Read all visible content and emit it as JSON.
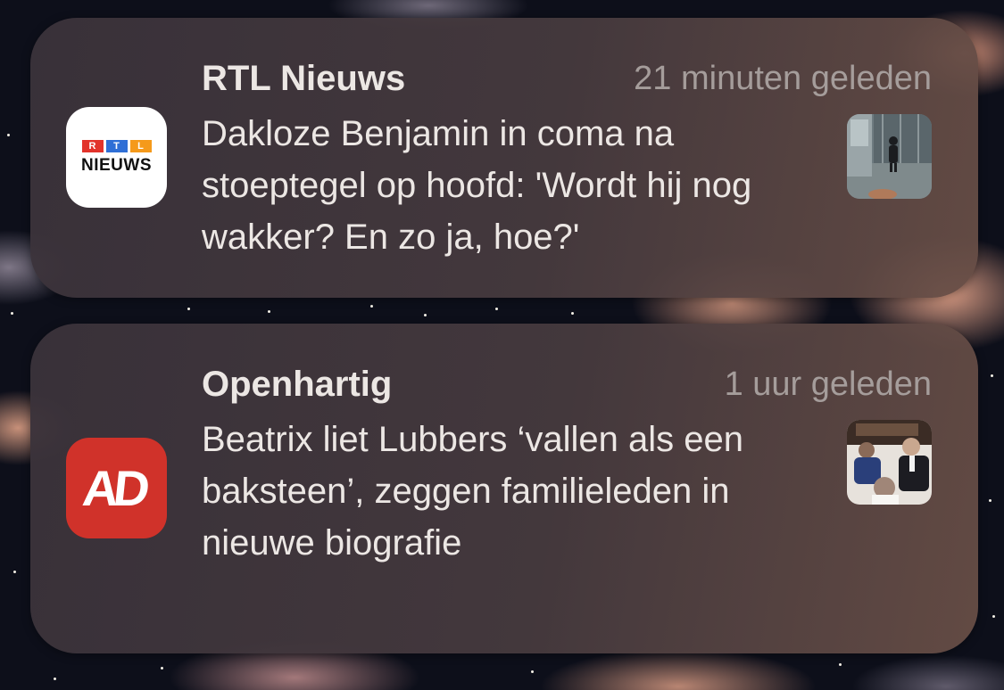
{
  "notifications": [
    {
      "app_name": "RTL Nieuws",
      "time": "21 minuten geleden",
      "message": "Dakloze Benjamin in coma na stoeptegel op hoofd: 'Wordt hij nog wakker? En zo ja, hoe?'",
      "icon": {
        "name": "rtl-nieuws-app-icon",
        "letters": [
          "R",
          "T",
          "L"
        ],
        "word": "NIEUWS",
        "colors": [
          "#e2332b",
          "#2f6fd6",
          "#f59a1b"
        ]
      },
      "thumbnail": "street-scene-photo"
    },
    {
      "app_name": "Openhartig",
      "time": "1 uur geleden",
      "message": "Beatrix liet Lubbers ‘vallen als een baksteen’, zeggen familieleden in nieuwe biografie",
      "icon": {
        "name": "ad-app-icon",
        "text": "AD",
        "color": "#d0322a"
      },
      "thumbnail": "people-meeting-photo"
    }
  ]
}
